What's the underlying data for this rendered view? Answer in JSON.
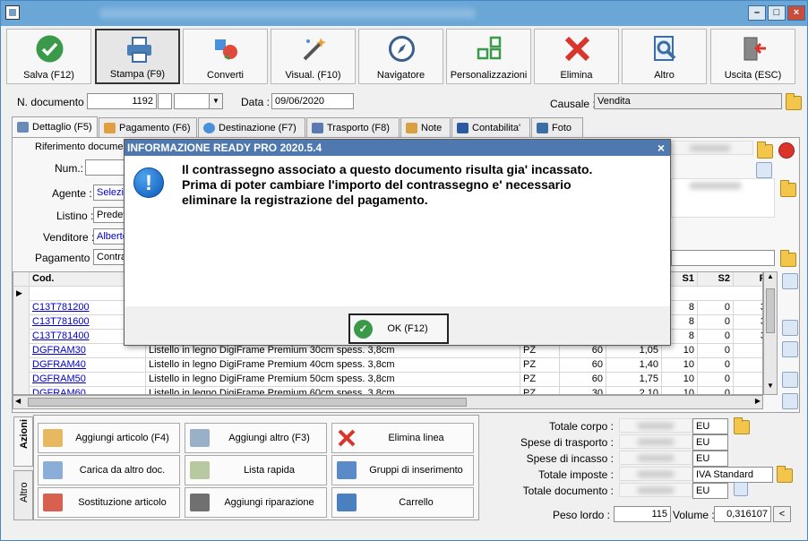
{
  "colors": {
    "accent": "#4e78ae",
    "ok": "#3a9a4a",
    "danger": "#d9352b",
    "folder": "#f3c54a"
  },
  "toolbar": [
    {
      "label": "Salva (F12)",
      "icon": "check-circle-icon"
    },
    {
      "label": "Stampa (F9)",
      "icon": "printer-icon"
    },
    {
      "label": "Converti",
      "icon": "convert-icon"
    },
    {
      "label": "Visual. (F10)",
      "icon": "magic-wand-icon"
    },
    {
      "label": "Navigatore",
      "icon": "compass-icon"
    },
    {
      "label": "Personalizzazioni",
      "icon": "grid-icon"
    },
    {
      "label": "Elimina",
      "icon": "delete-x-icon"
    },
    {
      "label": "Altro",
      "icon": "search-document-icon"
    },
    {
      "label": "Uscita (ESC)",
      "icon": "exit-door-icon"
    }
  ],
  "header": {
    "n_documento_label": "N. documento :",
    "n_documento": "1192",
    "data_label": "Data :",
    "data": "09/06/2020",
    "causale_label": "Causale :",
    "causale": "Vendita"
  },
  "tabs": [
    "Dettaglio (F5)",
    "Pagamento (F6)",
    "Destinazione (F7)",
    "Trasporto (F8)",
    "Note",
    "Contabilita'",
    "Foto"
  ],
  "dettaglio": {
    "riferimento_label": "Riferimento documen",
    "num_label": "Num.:",
    "agente_label": "Agente :",
    "agente": "Selezio",
    "listino_label": "Listino :",
    "listino": "Predef",
    "venditore_label": "Venditore :",
    "venditore": "Alberto",
    "pagamento_label": "Pagamento :",
    "pagamento": "Contra"
  },
  "grid": {
    "col_cod": "Cod.",
    "col_s1": "S1",
    "col_s2": "S2",
    "col_p": "P",
    "rows": [
      {
        "cod": "C13T781200",
        "desc": "",
        "um": "",
        "qta": "",
        "prezzo": "",
        "s1": "8",
        "s2": "0",
        "p": "3"
      },
      {
        "cod": "C13T781600",
        "desc": "",
        "um": "",
        "qta": "",
        "prezzo": "",
        "s1": "8",
        "s2": "0",
        "p": "3"
      },
      {
        "cod": "C13T781400",
        "desc": "",
        "um": "",
        "qta": "",
        "prezzo": "",
        "s1": "8",
        "s2": "0",
        "p": "3"
      },
      {
        "cod": "DGFRAM30",
        "desc": "Listello in legno DigiFrame Premium 30cm spess. 3,8cm",
        "um": "PZ",
        "qta": "60",
        "prezzo": "1,05",
        "s1": "10",
        "s2": "0",
        "p": ""
      },
      {
        "cod": "DGFRAM40",
        "desc": "Listello in legno DigiFrame Premium 40cm spess. 3,8cm",
        "um": "PZ",
        "qta": "60",
        "prezzo": "1,40",
        "s1": "10",
        "s2": "0",
        "p": ""
      },
      {
        "cod": "DGFRAM50",
        "desc": "Listello in legno DigiFrame Premium 50cm spess. 3,8cm",
        "um": "PZ",
        "qta": "60",
        "prezzo": "1,75",
        "s1": "10",
        "s2": "0",
        "p": ""
      },
      {
        "cod": "DGFRAM60",
        "desc": "Listello in legno DigiFrame Premium 60cm spess. 3,8cm",
        "um": "PZ",
        "qta": "30",
        "prezzo": "2,10",
        "s1": "10",
        "s2": "0",
        "p": ""
      }
    ]
  },
  "actions": {
    "vtab_azioni": "Azioni",
    "vtab_altro": "Altro",
    "buttons": [
      "Aggiungi articolo (F4)",
      "Aggiungi altro (F3)",
      "Elimina linea",
      "Carica da altro doc.",
      "Lista rapida",
      "Gruppi di inserimento",
      "Sostituzione articolo",
      "Aggiungi riparazione",
      "Carrello"
    ]
  },
  "totals": {
    "totale_corpo_label": "Totale corpo :",
    "spese_trasporto_label": "Spese di trasporto :",
    "spese_incasso_label": "Spese di incasso :",
    "totale_imposte_label": "Totale imposte :",
    "totale_documento_label": "Totale documento :",
    "currency": "EU",
    "iva_label": "IVA Standard",
    "peso_lordo_label": "Peso lordo :",
    "peso_lordo": "115",
    "volume_label": "Volume :",
    "volume": "0,316107",
    "volume_btn": "<"
  },
  "dialog": {
    "title": "INFORMAZIONE READY PRO 2020.5.4",
    "close": "×",
    "icon_text": "!",
    "message": "Il contrassegno associato a questo documento risulta gia' incassato.\nPrima di poter cambiare l'importo del contrassegno e' necessario\neliminare la registrazione del pagamento.",
    "ok_label": "OK (F12)",
    "ok_icon": "✓"
  }
}
